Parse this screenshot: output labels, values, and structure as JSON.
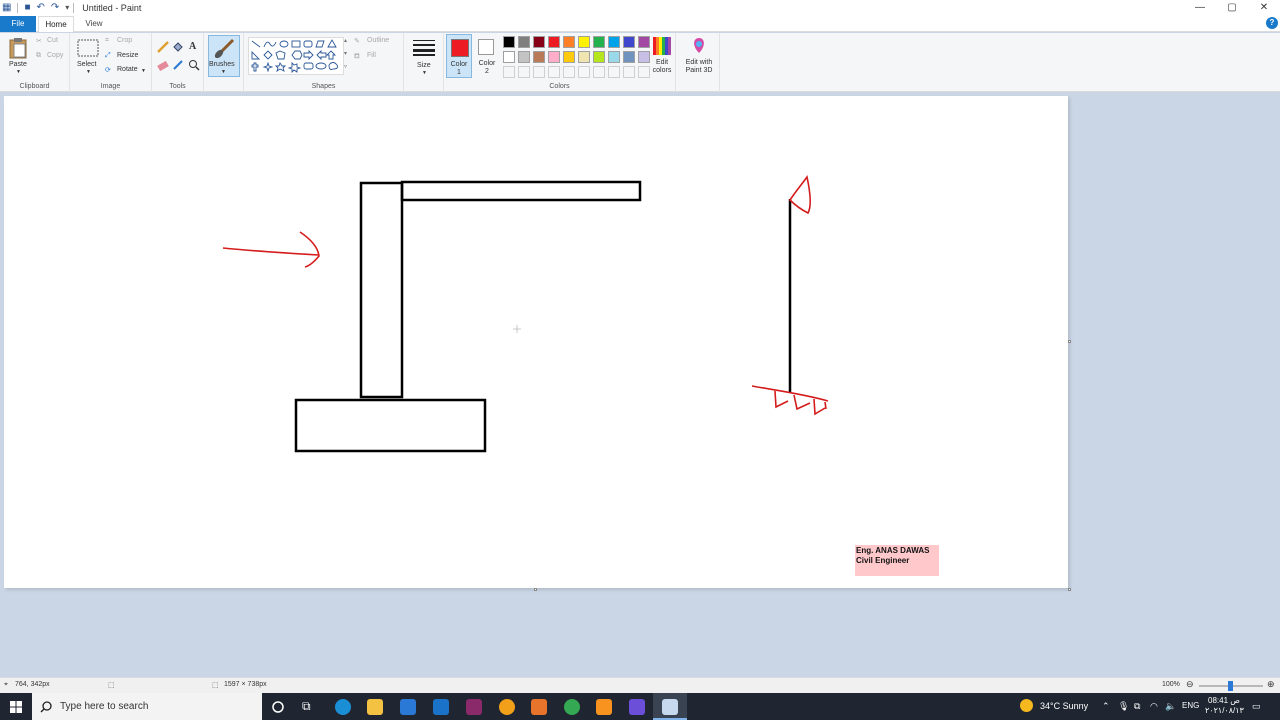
{
  "window": {
    "title": "Untitled - Paint"
  },
  "tabs": {
    "file": "File",
    "home": "Home",
    "view": "View"
  },
  "ribbon": {
    "clipboard": {
      "paste": "Paste",
      "cut": "Cut",
      "copy": "Copy",
      "label": "Clipboard"
    },
    "image": {
      "select": "Select",
      "crop": "Crop",
      "resize": "Resize",
      "rotate": "Rotate",
      "label": "Image"
    },
    "tools": {
      "label": "Tools"
    },
    "brushes": {
      "label": "Brushes"
    },
    "shapes": {
      "outline": "Outline",
      "fill": "Fill",
      "label": "Shapes"
    },
    "size": {
      "label": "Size"
    },
    "colors": {
      "color1_label": "Color 1",
      "color2_label": "Color 2",
      "edit_colors": "Edit colors",
      "group_label": "Colors",
      "color1": "#ed1c24",
      "color2": "#ffffff",
      "palette_row1": [
        "#000000",
        "#7f7f7f",
        "#880015",
        "#ed1c24",
        "#ff7f27",
        "#fff200",
        "#22b14c",
        "#00a2e8",
        "#3f48cc",
        "#a349a4"
      ],
      "palette_row2": [
        "#ffffff",
        "#c3c3c3",
        "#b97a57",
        "#ffaec9",
        "#ffc90e",
        "#efe4b0",
        "#b5e61d",
        "#99d9ea",
        "#7092be",
        "#c8bfe7"
      ]
    },
    "paint3d": {
      "label": "Edit with Paint 3D"
    }
  },
  "canvas": {
    "credit_line1": "Eng. ANAS DAWAS",
    "credit_line2": "Civil Engineer"
  },
  "statusbar": {
    "cursor_pos": "764, 342px",
    "canvas_size": "1597 × 738px",
    "zoom": "100%"
  },
  "taskbar": {
    "search_placeholder": "Type here to search",
    "weather": "34°C  Sunny",
    "language": "ENG",
    "time": "08:41 ص",
    "date": "٢٠٢١/٠٨/١٣"
  }
}
